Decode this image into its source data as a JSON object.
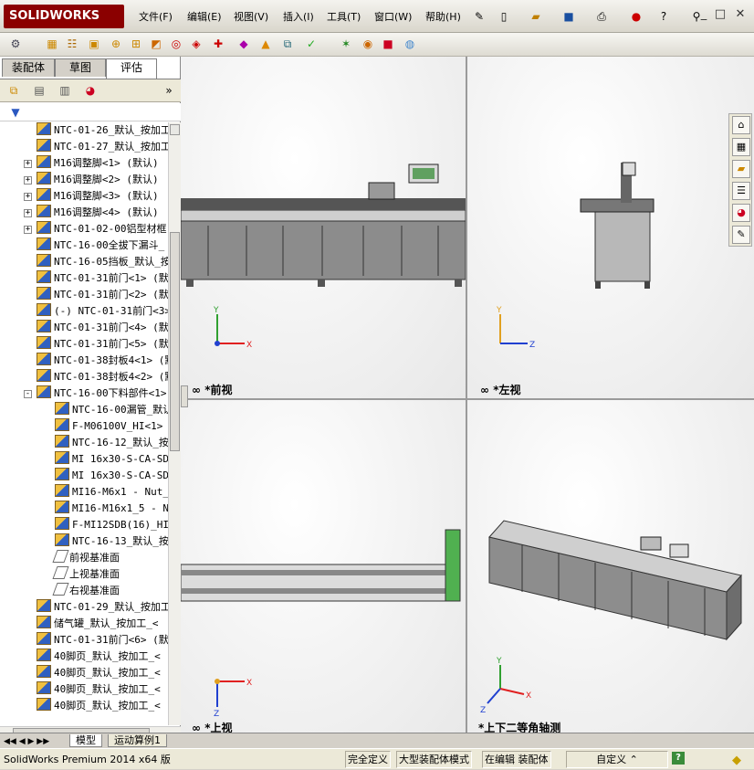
{
  "app": {
    "logo_text": "SOLIDWORKS",
    "brand_color": "#8b0000"
  },
  "menu": [
    {
      "label": "文件(F)"
    },
    {
      "label": "编辑(E)"
    },
    {
      "label": "视图(V)"
    },
    {
      "label": "插入(I)"
    },
    {
      "label": "工具(T)"
    },
    {
      "label": "窗口(W)"
    },
    {
      "label": "帮助(H)"
    }
  ],
  "panel": {
    "tabs": [
      "装配体",
      "草图",
      "评估"
    ],
    "active_tab": "评估",
    "tree": [
      {
        "label": "NTC-01-26_默认_按加工",
        "level": 1,
        "icon": "part-icon",
        "exp": ""
      },
      {
        "label": "NTC-01-27_默认_按加工",
        "level": 1,
        "icon": "part-icon",
        "exp": ""
      },
      {
        "label": "M16调整脚<1> (默认)",
        "level": 1,
        "icon": "part-icon",
        "exp": "+"
      },
      {
        "label": "M16调整脚<2> (默认)",
        "level": 1,
        "icon": "part-icon",
        "exp": "+"
      },
      {
        "label": "M16调整脚<3> (默认)",
        "level": 1,
        "icon": "part-icon",
        "exp": "+"
      },
      {
        "label": "M16调整脚<4> (默认)",
        "level": 1,
        "icon": "part-icon",
        "exp": "+"
      },
      {
        "label": "NTC-01-02-00铝型材框",
        "level": 1,
        "icon": "part-icon",
        "exp": "+"
      },
      {
        "label": "NTC-16-00全拔下漏斗_",
        "level": 1,
        "icon": "part-icon",
        "exp": ""
      },
      {
        "label": "NTC-16-05挡板_默认_按",
        "level": 1,
        "icon": "part-icon",
        "exp": ""
      },
      {
        "label": "NTC-01-31前门<1> (默",
        "level": 1,
        "icon": "part-icon",
        "exp": ""
      },
      {
        "label": "NTC-01-31前门<2> (默",
        "level": 1,
        "icon": "part-icon",
        "exp": ""
      },
      {
        "label": "(-) NTC-01-31前门<3>",
        "level": 1,
        "icon": "part-icon",
        "exp": ""
      },
      {
        "label": "NTC-01-31前门<4> (默",
        "level": 1,
        "icon": "part-icon",
        "exp": ""
      },
      {
        "label": "NTC-01-31前门<5> (默",
        "level": 1,
        "icon": "part-icon",
        "exp": ""
      },
      {
        "label": "NTC-01-38封板4<1> (默",
        "level": 1,
        "icon": "part-icon",
        "exp": ""
      },
      {
        "label": "NTC-01-38封板4<2> (默",
        "level": 1,
        "icon": "part-icon",
        "exp": ""
      },
      {
        "label": "NTC-16-00下料部件<1>",
        "level": 1,
        "icon": "part-icon",
        "exp": "-"
      },
      {
        "label": "NTC-16-00漏管_默认",
        "level": 2,
        "icon": "part-icon",
        "exp": ""
      },
      {
        "label": "F-M06100V_HI<1> (",
        "level": 2,
        "icon": "part-icon",
        "exp": ""
      },
      {
        "label": "NTC-16-12_默认_按",
        "level": 2,
        "icon": "part-icon",
        "exp": ""
      },
      {
        "label": "MI 16x30-S-CA-SDE",
        "level": 2,
        "icon": "part-icon",
        "exp": ""
      },
      {
        "label": "MI 16x30-S-CA-SDE",
        "level": 2,
        "icon": "part-icon",
        "exp": ""
      },
      {
        "label": "MI16-M6x1 - Nut_H",
        "level": 2,
        "icon": "part-icon",
        "exp": ""
      },
      {
        "label": "MI16-M16x1_5 - Nu",
        "level": 2,
        "icon": "part-icon",
        "exp": ""
      },
      {
        "label": "F-MI12SDB(16)_HI<",
        "level": 2,
        "icon": "part-icon",
        "exp": ""
      },
      {
        "label": "NTC-16-13_默认_按",
        "level": 2,
        "icon": "part-icon",
        "exp": ""
      },
      {
        "label": "前视基准面",
        "level": 2,
        "icon": "plane-icon",
        "exp": ""
      },
      {
        "label": "上视基准面",
        "level": 2,
        "icon": "plane-icon",
        "exp": ""
      },
      {
        "label": "右视基准面",
        "level": 2,
        "icon": "plane-icon",
        "exp": ""
      },
      {
        "label": "NTC-01-29_默认_按加工",
        "level": 1,
        "icon": "part-icon",
        "exp": ""
      },
      {
        "label": "储气罐_默认_按加工_<",
        "level": 1,
        "icon": "part-icon",
        "exp": ""
      },
      {
        "label": "NTC-01-31前门<6> (默",
        "level": 1,
        "icon": "part-icon",
        "exp": ""
      },
      {
        "label": "40脚页_默认_按加工_<",
        "level": 1,
        "icon": "part-icon",
        "exp": ""
      },
      {
        "label": "40脚页_默认_按加工_<",
        "level": 1,
        "icon": "part-icon",
        "exp": ""
      },
      {
        "label": "40脚页_默认_按加工_<",
        "level": 1,
        "icon": "part-icon",
        "exp": ""
      },
      {
        "label": "40脚页_默认_按加工_<",
        "level": 1,
        "icon": "part-icon",
        "exp": ""
      }
    ]
  },
  "viewports": [
    {
      "label": "*前视",
      "axes": [
        "Y",
        "X"
      ]
    },
    {
      "label": "*左视",
      "axes": [
        "Y",
        "Z"
      ]
    },
    {
      "label": "*上视",
      "axes": [
        "X",
        "Z"
      ]
    },
    {
      "label": "*上下二等角轴测",
      "axes": [
        "Y",
        "X",
        "Z"
      ]
    }
  ],
  "bottom_tabs": [
    "模型",
    "运动算例1"
  ],
  "status": {
    "product": "SolidWorks Premium 2014 x64 版",
    "fully_defined": "完全定义",
    "mode": "大型装配体模式",
    "editing": "在编辑 装配体",
    "units": "自定义",
    "help": "?"
  },
  "colors": {
    "machine_gray": "#8a8a8a",
    "axis_red": "#e02020",
    "axis_green": "#30a030",
    "axis_blue": "#2040d0",
    "axis_orange": "#e0a020"
  }
}
